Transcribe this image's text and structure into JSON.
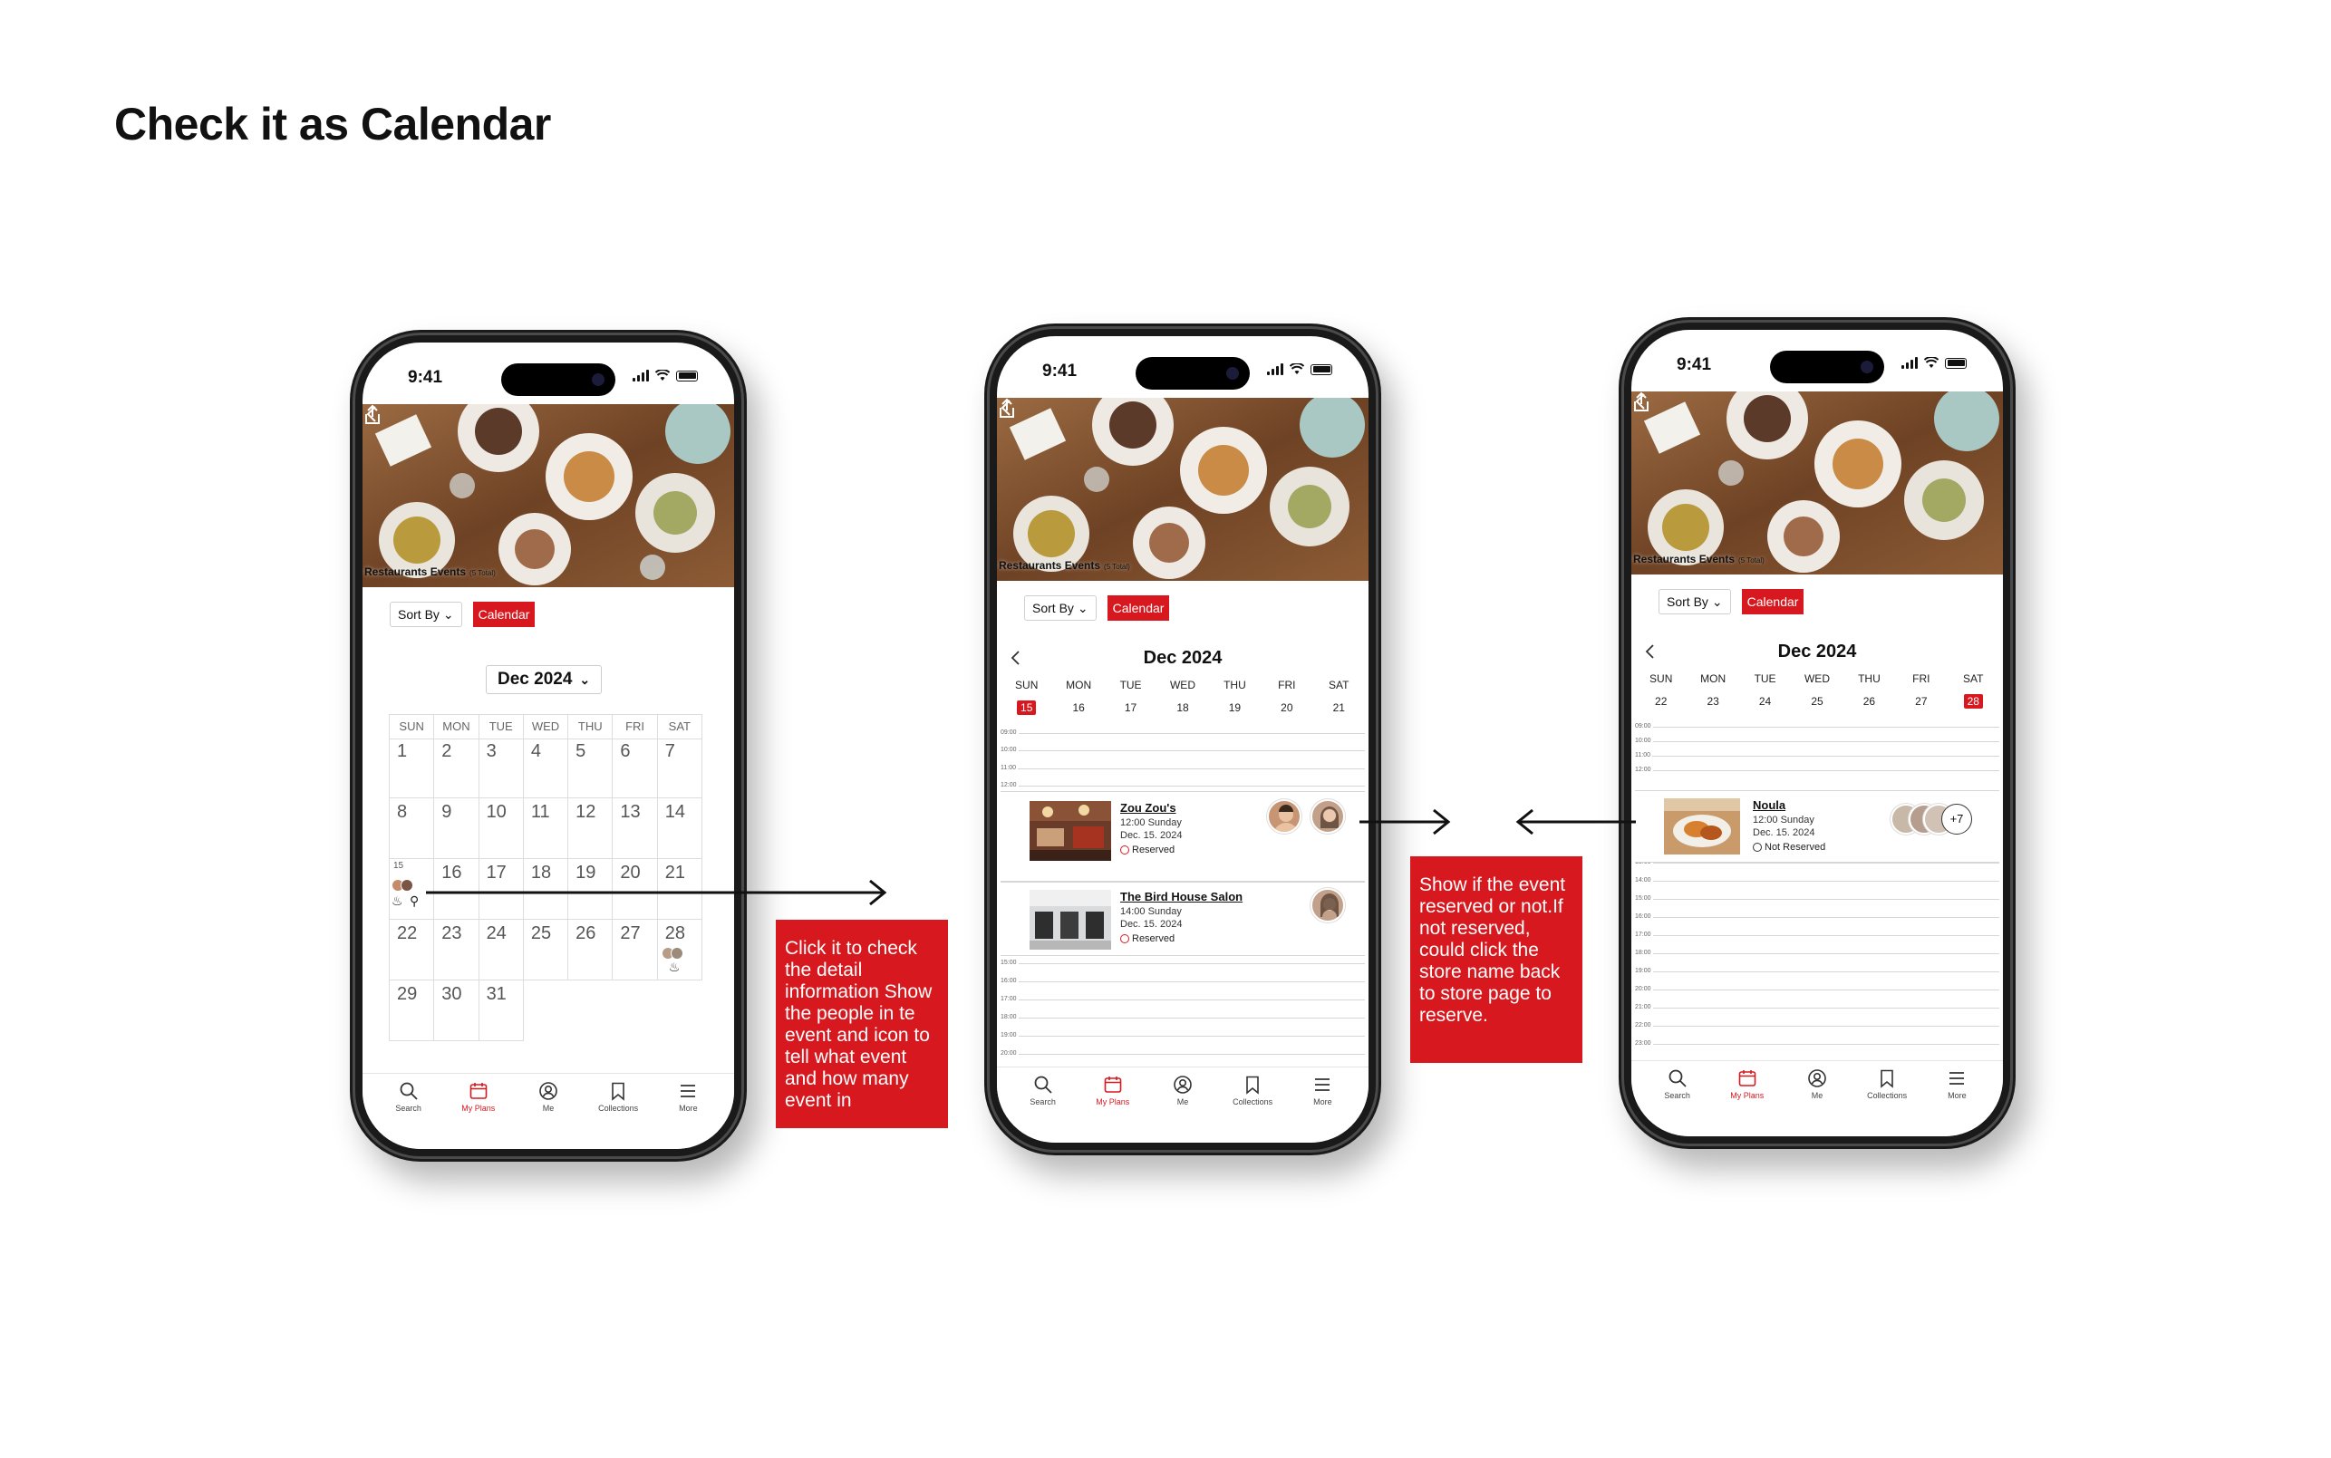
{
  "title": "Check it as Calendar",
  "status_time": "9:41",
  "hero": {
    "title": "Restaurants Events",
    "count": "(5 Total)"
  },
  "toolbar": {
    "sort_label": "Sort By",
    "calendar_label": "Calendar"
  },
  "month_view": {
    "month_label": "Dec 2024",
    "weekdays": [
      "SUN",
      "MON",
      "TUE",
      "WED",
      "THU",
      "FRI",
      "SAT"
    ],
    "weeks": [
      [
        "1",
        "2",
        "3",
        "4",
        "5",
        "6",
        "7"
      ],
      [
        "8",
        "9",
        "10",
        "11",
        "12",
        "13",
        "14"
      ],
      [
        "15",
        "16",
        "17",
        "18",
        "19",
        "20",
        "21"
      ],
      [
        "22",
        "23",
        "24",
        "25",
        "26",
        "27",
        "28"
      ],
      [
        "29",
        "30",
        "31"
      ]
    ]
  },
  "week_view_1": {
    "month_label": "Dec 2024",
    "weekdays": [
      "SUN",
      "MON",
      "TUE",
      "WED",
      "THU",
      "FRI",
      "SAT"
    ],
    "dates": [
      "15",
      "16",
      "17",
      "18",
      "19",
      "20",
      "21"
    ],
    "selected_index": 0,
    "hours": [
      "09:00",
      "10:00",
      "11:00",
      "12:00",
      "13:00",
      "14:00",
      "15:00",
      "16:00",
      "17:00",
      "18:00",
      "19:00",
      "20:00",
      "21:00"
    ],
    "events": [
      {
        "name": "Zou Zou's",
        "time": "12:00 Sunday",
        "date": "Dec. 15. 2024",
        "status": "Reserved"
      },
      {
        "name": "The Bird House Salon",
        "time": "14:00 Sunday",
        "date": "Dec. 15. 2024",
        "status": "Reserved"
      }
    ]
  },
  "week_view_2": {
    "month_label": "Dec 2024",
    "weekdays": [
      "SUN",
      "MON",
      "TUE",
      "WED",
      "THU",
      "FRI",
      "SAT"
    ],
    "dates": [
      "22",
      "23",
      "24",
      "25",
      "26",
      "27",
      "28"
    ],
    "selected_index": 6,
    "hours": [
      "09:00",
      "10:00",
      "11:00",
      "12:00",
      "13:00",
      "14:00",
      "15:00",
      "16:00",
      "17:00",
      "18:00",
      "19:00",
      "20:00",
      "21:00",
      "22:00",
      "23:00"
    ],
    "events": [
      {
        "name": "Noula",
        "time": "12:00 Sunday",
        "date": "Dec. 15. 2024",
        "status": "Not Reserved",
        "more": "+7"
      }
    ]
  },
  "tabs": [
    {
      "label": "Search",
      "icon": "search-icon"
    },
    {
      "label": "My Plans",
      "icon": "calendar-icon"
    },
    {
      "label": "Me",
      "icon": "profile-icon"
    },
    {
      "label": "Collections",
      "icon": "bookmark-icon"
    },
    {
      "label": "More",
      "icon": "menu-icon"
    }
  ],
  "notes": {
    "click_detail": "Click it to check the detail information Show the people in te event and icon to tell what event and how many event in",
    "reserved_info": "Show if the event reserved or not.If not reserved, could click the store name back to store page to reserve."
  },
  "colors": {
    "accent": "#d7191f",
    "frame": "#1a1a1a"
  }
}
